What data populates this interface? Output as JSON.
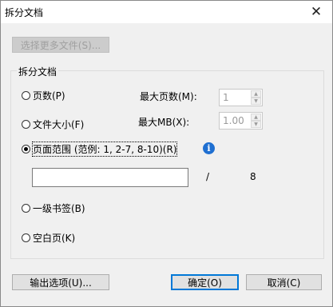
{
  "window": {
    "title": "拆分文档",
    "close_glyph": "✕"
  },
  "select_more_button": "选择更多文件(S)...",
  "group": {
    "label": "拆分文档",
    "option_pages": "页数(P)",
    "option_file_size": "文件大小(F)",
    "option_page_range": "页面范围 (范例:  1, 2-7, 8-10)(R)",
    "option_bookmarks": "一级书签(B)",
    "option_blank_pages": "空白页(K)",
    "max_pages_label": "最大页数(M):",
    "max_pages_value": "1",
    "max_mb_label": "最大MB(X):",
    "max_mb_value": "1.00",
    "range_input_value": "",
    "page_separator": "/",
    "total_pages": "8",
    "selected_option": "page_range"
  },
  "buttons": {
    "output_options": "输出选项(U)...",
    "ok": "确定(O)",
    "cancel": "取消(C)"
  },
  "icons": {
    "info": "i",
    "arrow_up": "▲",
    "arrow_down": "▼"
  }
}
